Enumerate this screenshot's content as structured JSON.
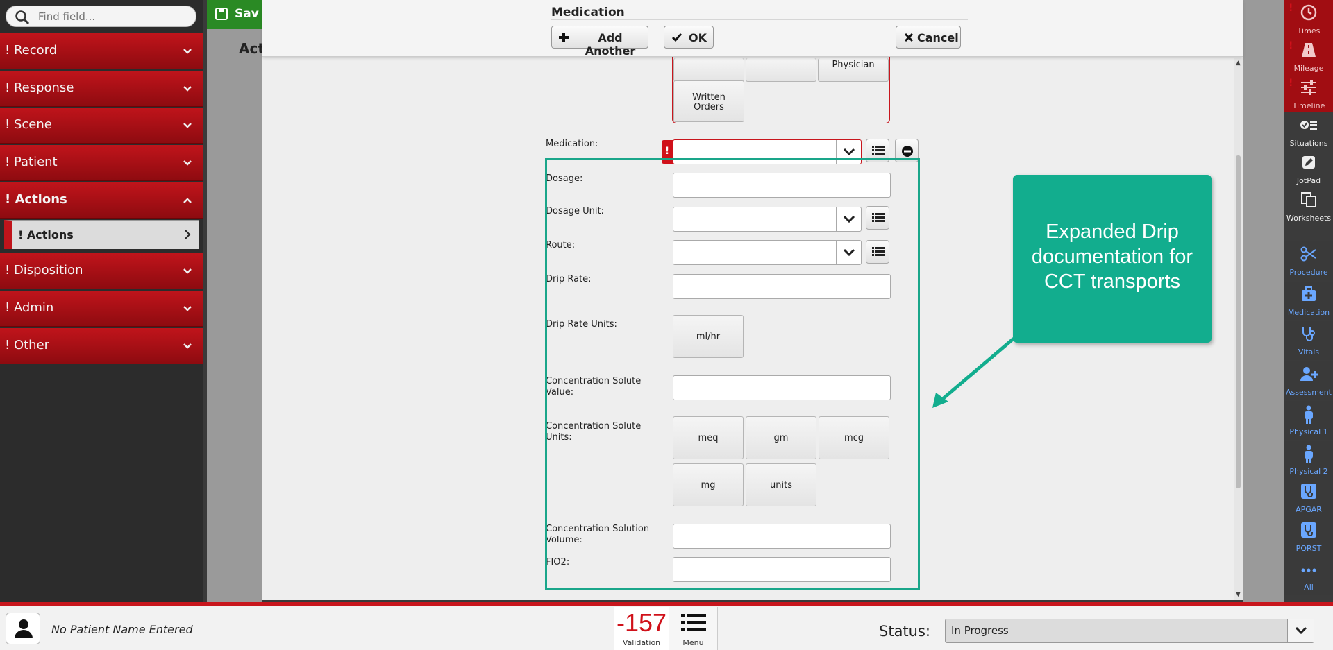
{
  "search": {
    "placeholder": "Find field..."
  },
  "sidebar": {
    "sections": [
      {
        "label": "! Record"
      },
      {
        "label": "! Response"
      },
      {
        "label": "! Scene"
      },
      {
        "label": "! Patient"
      },
      {
        "label": "! Actions"
      },
      {
        "label": "! Disposition"
      },
      {
        "label": "! Admin"
      },
      {
        "label": "! Other"
      }
    ],
    "active_sub": "! Actions"
  },
  "background": {
    "save_label": "Sav",
    "panel_title": "Act"
  },
  "modal": {
    "title": "Medication",
    "add_another": "Add Another",
    "ok": "OK",
    "cancel": "Cancel"
  },
  "form": {
    "top_options": [
      "",
      "",
      "Physician"
    ],
    "written_orders": [
      "Written",
      "Orders"
    ],
    "fields": {
      "medication": "Medication:",
      "dosage": "Dosage:",
      "dosage_unit": "Dosage Unit:",
      "route": "Route:",
      "drip_rate": "Drip Rate:",
      "drip_rate_units": "Drip Rate Units:",
      "conc_solute_value": [
        "Concentration Solute",
        "Value:"
      ],
      "conc_solute_units": [
        "Concentration Solute",
        "Units:"
      ],
      "conc_solution_volume": [
        "Concentration Solution",
        "Volume:"
      ],
      "fio2": "FIO2:"
    },
    "drip_rate_unit_options": [
      "ml/hr"
    ],
    "solute_unit_options": [
      "meq",
      "gm",
      "mcg",
      "mg",
      "units"
    ]
  },
  "callout": {
    "text": "Expanded Drip documentation for CCT transports",
    "color": "#12ad8e"
  },
  "rail": [
    {
      "label": "Times",
      "icon": "clock-icon",
      "flag": "!"
    },
    {
      "label": "Mileage",
      "icon": "road-icon",
      "flag": "!"
    },
    {
      "label": "Timeline",
      "icon": "sliders-icon",
      "flag": "!"
    },
    {
      "label": "Situations",
      "icon": "checklist-icon"
    },
    {
      "label": "JotPad",
      "icon": "pencil-icon"
    },
    {
      "label": "Worksheets",
      "icon": "copy-icon"
    },
    {
      "label": "Procedure",
      "icon": "scissors-icon"
    },
    {
      "label": "Medication",
      "icon": "medkit-icon"
    },
    {
      "label": "Vitals",
      "icon": "stethoscope-icon"
    },
    {
      "label": "Assessment",
      "icon": "user-plus-icon"
    },
    {
      "label": "Physical 1",
      "icon": "person-icon"
    },
    {
      "label": "Physical 2",
      "icon": "person-icon"
    },
    {
      "label": "APGAR",
      "icon": "stethoscope-box-icon"
    },
    {
      "label": "PQRST",
      "icon": "stethoscope-box-icon"
    },
    {
      "label": "All",
      "icon": "ellipsis-icon"
    }
  ],
  "bottom": {
    "patient_name": "No Patient Name Entered",
    "validation_count": "-157",
    "validation_label": "Validation",
    "menu_label": "Menu",
    "status_label": "Status:",
    "status_value": "In Progress"
  },
  "colors": {
    "brand_red": "#c0141b",
    "accent_green": "#1aa68a",
    "save_green": "#2a8a24",
    "rail_blue": "#6aa7ff"
  }
}
